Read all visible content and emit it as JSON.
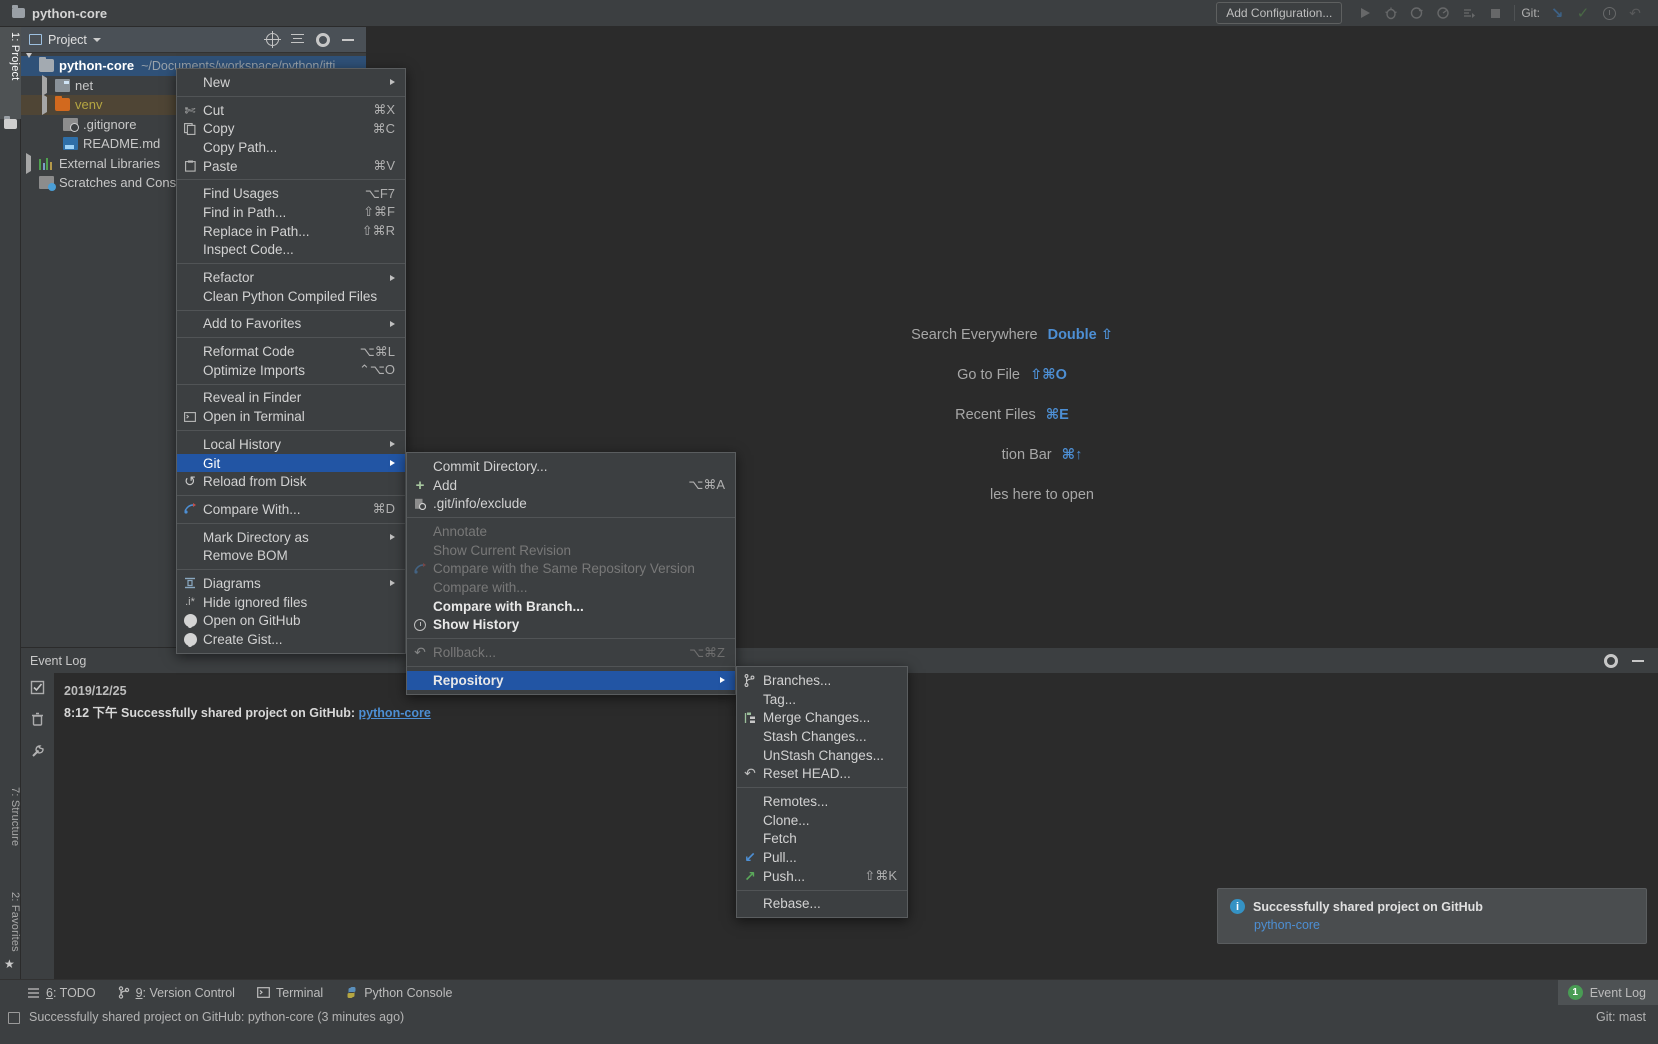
{
  "titlebar": {
    "project_name": "python-core",
    "add_configuration": "Add Configuration...",
    "git_label": "Git:",
    "icons": [
      "run-icon",
      "debug-icon",
      "run-coverage-icon",
      "profile-icon",
      "run-with-icon",
      "stop-icon",
      "update-project-icon",
      "commit-icon",
      "history-icon",
      "rollback-icon"
    ]
  },
  "left_strip": {
    "tabs": [
      {
        "label": "1: Project",
        "selected": true
      },
      {
        "label": "7: Structure",
        "selected": false
      },
      {
        "label": "2: Favorites",
        "selected": false
      }
    ]
  },
  "project_panel": {
    "title": "Project",
    "toolbar_icons": [
      "locate-icon",
      "collapse-all-icon",
      "settings-gear-icon",
      "hide-icon"
    ],
    "tree": [
      {
        "label": "python-core",
        "path": "~/Documents/workspace/python/itti",
        "depth": 0,
        "expanded": true,
        "icon": "project-folder-icon",
        "state": "selected-blue",
        "bold": true
      },
      {
        "label": "net",
        "path": "",
        "depth": 1,
        "expanded": false,
        "icon": "source-folder-icon",
        "state": "",
        "bold": false
      },
      {
        "label": "venv",
        "path": "",
        "depth": 1,
        "expanded": false,
        "icon": "excluded-folder-icon",
        "state": "selected-brown",
        "bold": false
      },
      {
        "label": ".gitignore",
        "path": "",
        "depth": 2,
        "expanded": null,
        "icon": "gitignore-file-icon",
        "state": "",
        "bold": false
      },
      {
        "label": "README.md",
        "path": "",
        "depth": 2,
        "expanded": null,
        "icon": "markdown-file-icon",
        "state": "",
        "bold": false
      },
      {
        "label": "External Libraries",
        "path": "",
        "depth": 0,
        "expanded": false,
        "icon": "libraries-icon",
        "state": "",
        "bold": false
      },
      {
        "label": "Scratches and Cons",
        "path": "",
        "depth": 0,
        "expanded": null,
        "icon": "scratches-icon",
        "state": "",
        "bold": false
      }
    ]
  },
  "editor_hints": [
    {
      "label": "Search Everywhere",
      "key": "Double ⇧"
    },
    {
      "label": "Go to File",
      "key": "⇧⌘O"
    },
    {
      "label": "Recent Files",
      "key": "⌘E"
    },
    {
      "label": "tion Bar",
      "key": "⌘↑"
    },
    {
      "label": "les here to open",
      "key": ""
    }
  ],
  "context_menu": {
    "items": [
      {
        "label": "New",
        "shortcut": "",
        "icon": "",
        "submenu": true,
        "disabled": false,
        "highlighted": false
      },
      {
        "sep": true
      },
      {
        "label": "Cut",
        "shortcut": "⌘X",
        "icon": "scissors-icon",
        "submenu": false,
        "disabled": false,
        "highlighted": false
      },
      {
        "label": "Copy",
        "shortcut": "⌘C",
        "icon": "copy-icon",
        "submenu": false,
        "disabled": false,
        "highlighted": false
      },
      {
        "label": "Copy Path...",
        "shortcut": "",
        "icon": "",
        "submenu": false,
        "disabled": false,
        "highlighted": false
      },
      {
        "label": "Paste",
        "shortcut": "⌘V",
        "icon": "paste-icon",
        "submenu": false,
        "disabled": false,
        "highlighted": false
      },
      {
        "sep": true
      },
      {
        "label": "Find Usages",
        "shortcut": "⌥F7",
        "icon": "",
        "submenu": false,
        "disabled": false,
        "highlighted": false
      },
      {
        "label": "Find in Path...",
        "shortcut": "⇧⌘F",
        "icon": "",
        "submenu": false,
        "disabled": false,
        "highlighted": false
      },
      {
        "label": "Replace in Path...",
        "shortcut": "⇧⌘R",
        "icon": "",
        "submenu": false,
        "disabled": false,
        "highlighted": false
      },
      {
        "label": "Inspect Code...",
        "shortcut": "",
        "icon": "",
        "submenu": false,
        "disabled": false,
        "highlighted": false
      },
      {
        "sep": true
      },
      {
        "label": "Refactor",
        "shortcut": "",
        "icon": "",
        "submenu": true,
        "disabled": false,
        "highlighted": false
      },
      {
        "label": "Clean Python Compiled Files",
        "shortcut": "",
        "icon": "",
        "submenu": false,
        "disabled": false,
        "highlighted": false
      },
      {
        "sep": true
      },
      {
        "label": "Add to Favorites",
        "shortcut": "",
        "icon": "",
        "submenu": true,
        "disabled": false,
        "highlighted": false
      },
      {
        "sep": true
      },
      {
        "label": "Reformat Code",
        "shortcut": "⌥⌘L",
        "icon": "",
        "submenu": false,
        "disabled": false,
        "highlighted": false
      },
      {
        "label": "Optimize Imports",
        "shortcut": "⌃⌥O",
        "icon": "",
        "submenu": false,
        "disabled": false,
        "highlighted": false
      },
      {
        "sep": true
      },
      {
        "label": "Reveal in Finder",
        "shortcut": "",
        "icon": "",
        "submenu": false,
        "disabled": false,
        "highlighted": false
      },
      {
        "label": "Open in Terminal",
        "shortcut": "",
        "icon": "terminal-icon",
        "submenu": false,
        "disabled": false,
        "highlighted": false
      },
      {
        "sep": true
      },
      {
        "label": "Local History",
        "shortcut": "",
        "icon": "",
        "submenu": true,
        "disabled": false,
        "highlighted": false
      },
      {
        "label": "Git",
        "shortcut": "",
        "icon": "",
        "submenu": true,
        "disabled": false,
        "highlighted": true
      },
      {
        "label": "Reload from Disk",
        "shortcut": "",
        "icon": "reload-icon",
        "submenu": false,
        "disabled": false,
        "highlighted": false
      },
      {
        "sep": true
      },
      {
        "label": "Compare With...",
        "shortcut": "⌘D",
        "icon": "compare-icon",
        "submenu": false,
        "disabled": false,
        "highlighted": false
      },
      {
        "sep": true
      },
      {
        "label": "Mark Directory as",
        "shortcut": "",
        "icon": "",
        "submenu": true,
        "disabled": false,
        "highlighted": false
      },
      {
        "label": "Remove BOM",
        "shortcut": "",
        "icon": "",
        "submenu": false,
        "disabled": false,
        "highlighted": false
      },
      {
        "sep": true
      },
      {
        "label": "Diagrams",
        "shortcut": "",
        "icon": "diagram-icon",
        "submenu": true,
        "disabled": false,
        "highlighted": false
      },
      {
        "label": "Hide ignored files",
        "shortcut": "",
        "icon": "hide-ignored-icon",
        "submenu": false,
        "disabled": false,
        "highlighted": false
      },
      {
        "label": "Open on GitHub",
        "shortcut": "",
        "icon": "github-icon",
        "submenu": false,
        "disabled": false,
        "highlighted": false
      },
      {
        "label": "Create Gist...",
        "shortcut": "",
        "icon": "github-icon",
        "submenu": false,
        "disabled": false,
        "highlighted": false
      }
    ]
  },
  "git_submenu": {
    "items": [
      {
        "label": "Commit Directory...",
        "shortcut": "",
        "icon": "",
        "submenu": false,
        "disabled": false,
        "highlighted": false
      },
      {
        "label": "Add",
        "shortcut": "⌥⌘A",
        "icon": "plus-icon",
        "submenu": false,
        "disabled": false,
        "highlighted": false
      },
      {
        "label": ".git/info/exclude",
        "shortcut": "",
        "icon": "gitignore-file-icon",
        "submenu": false,
        "disabled": false,
        "highlighted": false
      },
      {
        "sep": true
      },
      {
        "label": "Annotate",
        "shortcut": "",
        "icon": "",
        "submenu": false,
        "disabled": true,
        "highlighted": false
      },
      {
        "label": "Show Current Revision",
        "shortcut": "",
        "icon": "",
        "submenu": false,
        "disabled": true,
        "highlighted": false
      },
      {
        "label": "Compare with the Same Repository Version",
        "shortcut": "",
        "icon": "compare-icon",
        "submenu": false,
        "disabled": true,
        "highlighted": false
      },
      {
        "label": "Compare with...",
        "shortcut": "",
        "icon": "",
        "submenu": false,
        "disabled": true,
        "highlighted": false
      },
      {
        "label": "Compare with Branch...",
        "shortcut": "",
        "icon": "",
        "submenu": false,
        "disabled": false,
        "highlighted": false
      },
      {
        "label": "Show History",
        "shortcut": "",
        "icon": "history-clock-icon",
        "submenu": false,
        "disabled": false,
        "highlighted": false
      },
      {
        "sep": true
      },
      {
        "label": "Rollback...",
        "shortcut": "⌥⌘Z",
        "icon": "rollback-icon",
        "submenu": false,
        "disabled": true,
        "highlighted": false
      },
      {
        "sep": true
      },
      {
        "label": "Repository",
        "shortcut": "",
        "icon": "",
        "submenu": true,
        "disabled": false,
        "highlighted": true
      }
    ]
  },
  "repository_submenu": {
    "items": [
      {
        "label": "Branches...",
        "shortcut": "",
        "icon": "branch-icon",
        "submenu": false,
        "disabled": false,
        "highlighted": false
      },
      {
        "label": "Tag...",
        "shortcut": "",
        "icon": "",
        "submenu": false,
        "disabled": false,
        "highlighted": false
      },
      {
        "label": "Merge Changes...",
        "shortcut": "",
        "icon": "merge-icon",
        "submenu": false,
        "disabled": false,
        "highlighted": false
      },
      {
        "label": "Stash Changes...",
        "shortcut": "",
        "icon": "",
        "submenu": false,
        "disabled": false,
        "highlighted": false
      },
      {
        "label": "UnStash Changes...",
        "shortcut": "",
        "icon": "",
        "submenu": false,
        "disabled": false,
        "highlighted": false
      },
      {
        "label": "Reset HEAD...",
        "shortcut": "",
        "icon": "reset-icon",
        "submenu": false,
        "disabled": false,
        "highlighted": false
      },
      {
        "sep": true
      },
      {
        "label": "Remotes...",
        "shortcut": "",
        "icon": "",
        "submenu": false,
        "disabled": false,
        "highlighted": false
      },
      {
        "label": "Clone...",
        "shortcut": "",
        "icon": "",
        "submenu": false,
        "disabled": false,
        "highlighted": false
      },
      {
        "label": "Fetch",
        "shortcut": "",
        "icon": "",
        "submenu": false,
        "disabled": false,
        "highlighted": false
      },
      {
        "label": "Pull...",
        "shortcut": "",
        "icon": "pull-icon",
        "submenu": false,
        "disabled": false,
        "highlighted": false
      },
      {
        "label": "Push...",
        "shortcut": "⇧⌘K",
        "icon": "push-icon",
        "submenu": false,
        "disabled": false,
        "highlighted": false
      },
      {
        "sep": true
      },
      {
        "label": "Rebase...",
        "shortcut": "",
        "icon": "",
        "submenu": false,
        "disabled": false,
        "highlighted": false
      }
    ]
  },
  "event_log": {
    "title": "Event Log",
    "gutter_icons": [
      "mark-read-icon",
      "clear-all-icon",
      "settings-wrench-icon"
    ],
    "header_icons": [
      "gear-icon",
      "hide-icon"
    ],
    "entries": [
      {
        "date": "2019/12/25",
        "time": "8:12 下午",
        "message": "Successfully shared project on GitHub:",
        "link": "python-core"
      }
    ]
  },
  "toast": {
    "title": "Successfully shared project on GitHub",
    "link": "python-core",
    "icon": "info-icon"
  },
  "bottom_bar": {
    "items": [
      {
        "num": "6",
        "label": ": TODO",
        "icon": "todo-icon"
      },
      {
        "num": "9",
        "label": ": Version Control",
        "icon": "version-control-icon"
      },
      {
        "num": "",
        "label": "Terminal",
        "icon": "terminal-icon"
      },
      {
        "num": "",
        "label": "Python Console",
        "icon": "python-icon"
      }
    ],
    "event_log_label": "Event Log",
    "event_log_badge": "1"
  },
  "status_bar": {
    "message": "Successfully shared project on GitHub: python-core (3 minutes ago)",
    "right": "Git: mast"
  },
  "colors": {
    "accent_blue": "#2255a4",
    "link_blue": "#4d8fd4",
    "panel_bg": "#3c3f41",
    "editor_bg": "#2b2b2b",
    "selection_blue": "#2f5178",
    "venv_brown": "#4f4535"
  }
}
